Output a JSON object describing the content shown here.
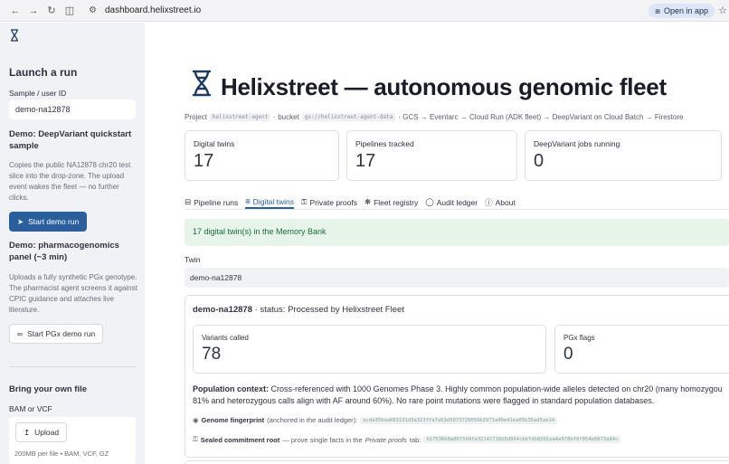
{
  "browser": {
    "url": "dashboard.helixstreet.io",
    "open_in_app": "Open in app"
  },
  "sidebar": {
    "logo_icon": "dna-icon",
    "heading": "Launch a run",
    "sample_label": "Sample / user ID",
    "sample_value": "demo-na12878",
    "demo1": {
      "title": "Demo: DeepVariant quickstart sample",
      "description": "Copies the public NA12878 chr20 test slice into the drop-zone. The upload event wakes the fleet — no further clicks.",
      "button": "Start demo run"
    },
    "demo2": {
      "title": "Demo: pharmacogenomics panel (~3 min)",
      "description": "Uploads a fully synthetic PGx genotype. The pharmacist agent screens it against CPIC guidance and attaches live literature.",
      "button": "Start PGx demo run"
    },
    "byo": {
      "title": "Bring your own file",
      "file_label": "BAM or VCF",
      "upload_button": "Upload",
      "hint": "200MB per file • BAM, VCF, GZ"
    }
  },
  "main": {
    "title": "Helixstreet — autonomous genomic fleet",
    "project": {
      "prefix": "Project",
      "project_id": "helixstreet-agent",
      "bucket_prefix": "· bucket",
      "bucket": "gs://helixstreet-agent-data",
      "pipeline": "· GCS → Eventarc → Cloud Run (ADK fleet) → DeepVariant on Cloud Batch → Firestore"
    },
    "metrics": [
      {
        "label": "Digital twins",
        "value": "17"
      },
      {
        "label": "Pipelines tracked",
        "value": "17"
      },
      {
        "label": "DeepVariant jobs running",
        "value": "0"
      }
    ],
    "tabs": [
      {
        "label": "Pipeline runs",
        "icon": "table-icon"
      },
      {
        "label": "Digital twins",
        "icon": "dna-icon"
      },
      {
        "label": "Private proofs",
        "icon": "lock-icon"
      },
      {
        "label": "Fleet registry",
        "icon": "asterisk-icon"
      },
      {
        "label": "Audit ledger",
        "icon": "shield-icon"
      },
      {
        "label": "About",
        "icon": "info-icon"
      }
    ],
    "active_tab": "Digital twins",
    "success_message": "17 digital twin(s) in the Memory Bank",
    "twin_label": "Twin",
    "twin_value": "demo-na12878",
    "twin_card": {
      "id": "demo-na12878",
      "status": "· status: Processed by Helixstreet Fleet",
      "metrics": [
        {
          "label": "Variants called",
          "value": "78"
        },
        {
          "label": "PGx flags",
          "value": "0"
        }
      ],
      "population_label": "Population context:",
      "population_line1": "Cross-referenced with 1000 Genomes Phase 3. Highly common population-wide alleles detected on chr20 (many homozygou",
      "population_line2": "81% and heterozygous calls align with AF around 60%). No rare point mutations were flagged in standard population databases.",
      "fingerprint_label": "Genome fingerprint",
      "fingerprint_note": "(anchored in the audit ledger):",
      "fingerprint_hash": "acda35baa083131d3a321ffa7a63d5073720059b2971a40e41ea05b35ad5ae14",
      "commitment_label": "Sealed commitment root",
      "commitment_note_a": "— prove single facts in the",
      "commitment_note_em": "Private proofs",
      "commitment_note_b": "tab:",
      "commitment_hash": "b17536b0a0615b9fa32141718b5d964cbb7db8391ea4a978bf8f054e6873a94c"
    }
  },
  "colors": {
    "accent": "#2a5f9e",
    "sidebar_bg": "#f0f2f6",
    "success_bg": "#e6f4ea",
    "success_text": "#1d6b3a"
  }
}
